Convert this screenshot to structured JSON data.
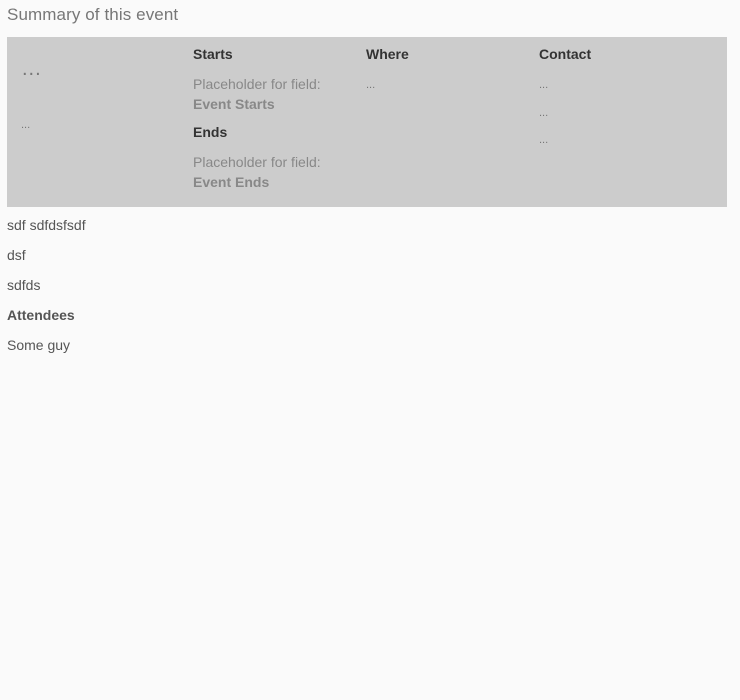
{
  "page": {
    "title": "Summary of this event"
  },
  "summary": {
    "left": {
      "big_ellipsis": "...",
      "small_ellipsis": "..."
    },
    "starts": {
      "heading": "Starts",
      "placeholder_text": "Placeholder for field:",
      "placeholder_field": "Event Starts"
    },
    "ends": {
      "heading": "Ends",
      "placeholder_text": "Placeholder for field:",
      "placeholder_field": "Event Ends"
    },
    "where": {
      "heading": "Where",
      "value": "..."
    },
    "contact": {
      "heading": "Contact",
      "values": [
        "...",
        "...",
        "..."
      ]
    }
  },
  "details": {
    "lines": [
      "sdf sdfdsfsdf",
      "dsf",
      "sdfds"
    ],
    "attendees_heading": "Attendees",
    "attendees": [
      "Some guy"
    ]
  }
}
